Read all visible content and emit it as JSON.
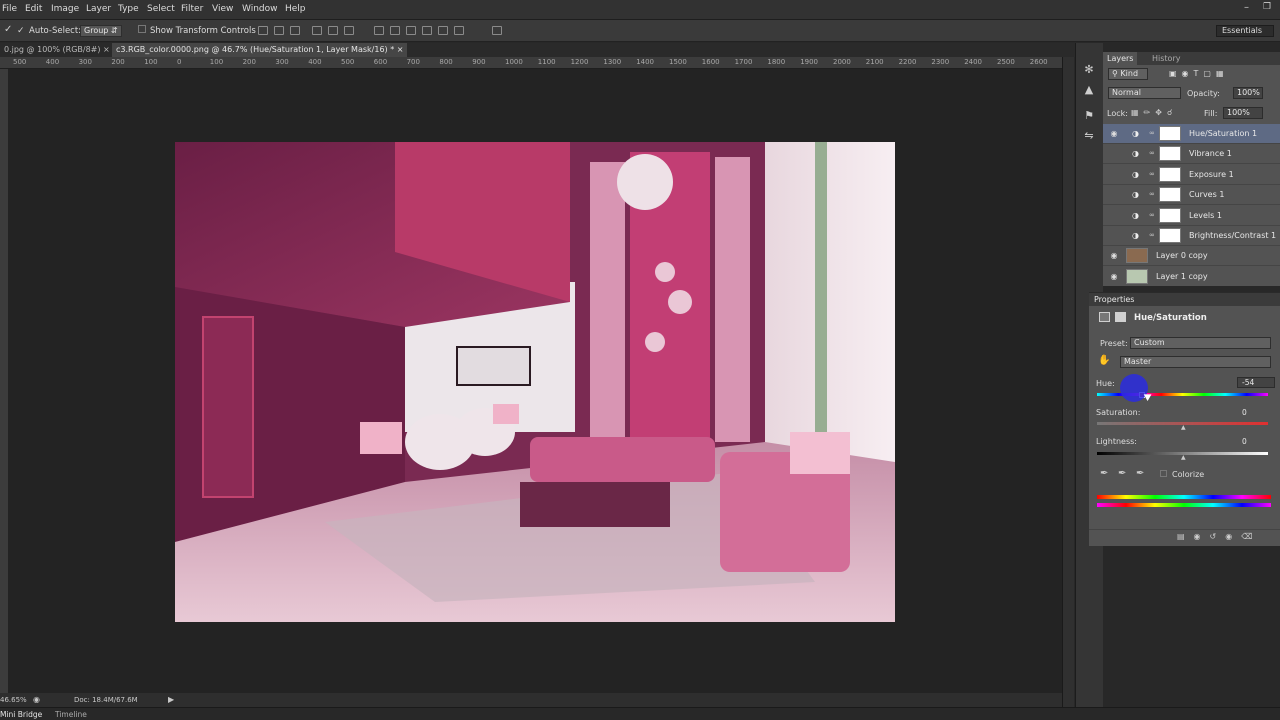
{
  "menu": [
    "File",
    "Edit",
    "Image",
    "Layer",
    "Type",
    "Select",
    "Filter",
    "View",
    "Window",
    "Help"
  ],
  "options": {
    "auto_select_label": "Auto-Select:",
    "auto_select_value": "Group",
    "show_transform": "Show Transform Controls",
    "workspace": "Essentials"
  },
  "tabs": [
    {
      "label": "0.jpg @ 100% (RGB/8#)"
    },
    {
      "label": "c3.RGB_color.0000.png @ 46.7% (Hue/Saturation 1, Layer Mask/16) *"
    }
  ],
  "ruler_ticks": [
    "500",
    "400",
    "300",
    "200",
    "100",
    "0",
    "100",
    "200",
    "300",
    "400",
    "500",
    "600",
    "700",
    "800",
    "900",
    "1000",
    "1100",
    "1200",
    "1300",
    "1400",
    "1500",
    "1600",
    "1700",
    "1800",
    "1900",
    "2000",
    "2100",
    "2200",
    "2300",
    "2400",
    "2500",
    "2600"
  ],
  "status": {
    "zoom": "46.65%",
    "doc": "Doc: 18.4M/67.6M"
  },
  "bottom_tabs": {
    "bridge": "Mini Bridge",
    "timeline": "Timeline"
  },
  "layers_panel": {
    "tab_layers": "Layers",
    "tab_history": "History",
    "kind": "Kind",
    "blend_mode": "Normal",
    "opacity_label": "Opacity:",
    "opacity_value": "100%",
    "lock_label": "Lock:",
    "fill_label": "Fill:",
    "fill_value": "100%",
    "layers": [
      {
        "name": "Hue/Saturation 1",
        "visible": true,
        "selected": true
      },
      {
        "name": "Vibrance 1",
        "visible": false,
        "selected": false
      },
      {
        "name": "Exposure 1",
        "visible": false,
        "selected": false
      },
      {
        "name": "Curves 1",
        "visible": false,
        "selected": false
      },
      {
        "name": "Levels 1",
        "visible": false,
        "selected": false
      },
      {
        "name": "Brightness/Contrast 1",
        "visible": false,
        "selected": false
      },
      {
        "name": "Layer 0 copy",
        "visible": true,
        "selected": false
      },
      {
        "name": "Layer 1 copy",
        "visible": true,
        "selected": false
      }
    ]
  },
  "properties": {
    "title": "Properties",
    "adjustment": "Hue/Saturation",
    "preset_label": "Preset:",
    "preset_value": "Custom",
    "channel": "Master",
    "hue_label": "Hue:",
    "hue_value": "-54",
    "saturation_label": "Saturation:",
    "saturation_value": "0",
    "lightness_label": "Lightness:",
    "lightness_value": "0",
    "colorize_label": "Colorize"
  },
  "colors": {
    "accent": "#3e5fd0",
    "selected_row": "#5e6a84",
    "cursor": "#2a2be0"
  }
}
